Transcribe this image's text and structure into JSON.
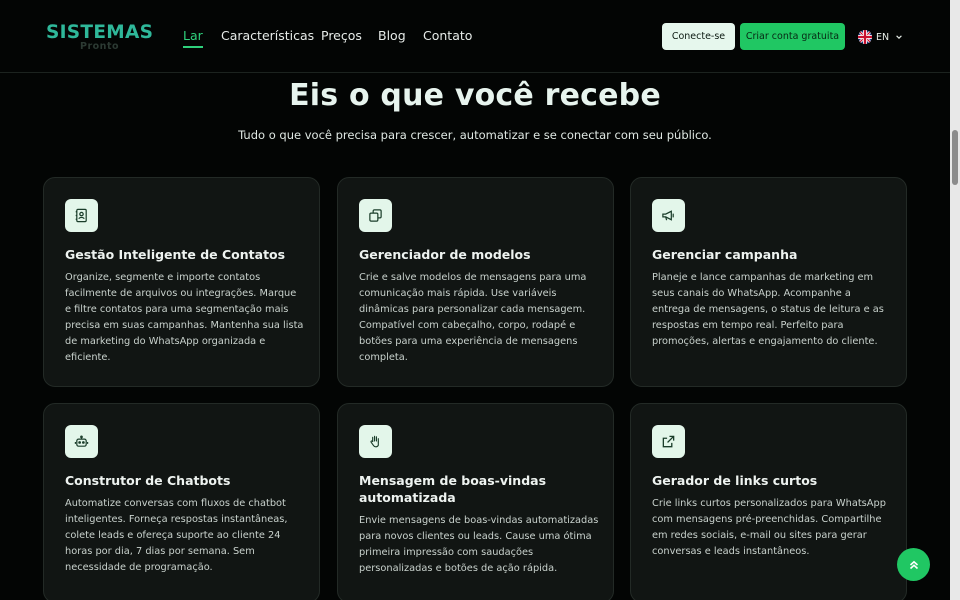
{
  "brand": {
    "name": "SISTEMAS",
    "tagline": "Pronto"
  },
  "nav": {
    "items": [
      "Lar",
      "Características",
      "Preços",
      "Blog",
      "Contato"
    ],
    "active": "Lar"
  },
  "header": {
    "login_label": "Conecte-se",
    "signup_label": "Criar conta gratuita",
    "language": "EN"
  },
  "hero": {
    "title": "Eis o que você recebe",
    "subtitle": "Tudo o que você precisa para crescer, automatizar e se conectar com seu público."
  },
  "features": [
    {
      "icon": "contacts-icon",
      "title": "Gestão Inteligente de Contatos",
      "description": "Organize, segmente e importe contatos facilmente de arquivos ou integrações. Marque e filtre contatos para uma segmentação mais precisa em suas campanhas. Mantenha sua lista de marketing do WhatsApp organizada e eficiente."
    },
    {
      "icon": "copy-icon",
      "title": "Gerenciador de modelos",
      "description": "Crie e salve modelos de mensagens para uma comunicação mais rápida. Use variáveis dinâmicas para personalizar cada mensagem. Compatível com cabeçalho, corpo, rodapé e botões para uma experiência de mensagens completa."
    },
    {
      "icon": "megaphone-icon",
      "title": "Gerenciar campanha",
      "description": "Planeje e lance campanhas de marketing em seus canais do WhatsApp. Acompanhe a entrega de mensagens, o status de leitura e as respostas em tempo real. Perfeito para promoções, alertas e engajamento do cliente."
    },
    {
      "icon": "robot-icon",
      "title": "Construtor de Chatbots",
      "description": "Automatize conversas com fluxos de chatbot inteligentes. Forneça respostas instantâneas, colete leads e ofereça suporte ao cliente 24 horas por dia, 7 dias por semana. Sem necessidade de programação."
    },
    {
      "icon": "waving-hand-icon",
      "title": "Mensagem de boas-vindas automatizada",
      "description": "Envie mensagens de boas-vindas automatizadas para novos clientes ou leads. Cause uma ótima primeira impressão com saudações personalizadas e botões de ação rápida."
    },
    {
      "icon": "external-link-icon",
      "title": "Gerador de links curtos",
      "description": "Crie links curtos personalizados para WhatsApp com mensagens pré-preenchidas. Compartilhe em redes sociais, e-mail ou sites para gerar conversas e leads instantâneos."
    }
  ],
  "colors": {
    "accent": "#20c763",
    "brand_teal": "#2fb89a",
    "card_bg": "#111513",
    "page_bg": "#030504"
  }
}
